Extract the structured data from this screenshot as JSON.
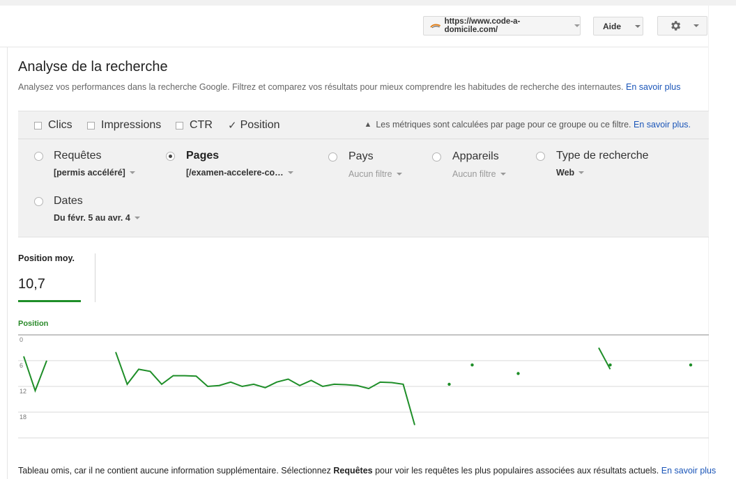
{
  "header": {
    "site_url": "https://www.code-a-domicile.com/",
    "help_label": "Aide"
  },
  "page": {
    "title": "Analyse de la recherche",
    "subtitle": "Analysez vos performances dans la recherche Google. Filtrez et comparez vos résultats pour mieux comprendre les habitudes de recherche des internautes.",
    "learn_more": "En savoir plus"
  },
  "metrics": {
    "items": [
      {
        "label": "Clics",
        "checked": false
      },
      {
        "label": "Impressions",
        "checked": false
      },
      {
        "label": "CTR",
        "checked": false
      },
      {
        "label": "Position",
        "checked": true
      }
    ],
    "notice": "Les métriques sont calculées par page pour ce groupe ou ce filtre.",
    "notice_link": "En savoir plus."
  },
  "dimensions": {
    "queries": {
      "label": "Requêtes",
      "value": "[permis accéléré]",
      "selected": false
    },
    "pages": {
      "label": "Pages",
      "value": "[/examen-accelere-co…",
      "selected": true
    },
    "countries": {
      "label": "Pays",
      "value": "Aucun filtre",
      "selected": false
    },
    "devices": {
      "label": "Appareils",
      "value": "Aucun filtre",
      "selected": false
    },
    "search_type": {
      "label": "Type de recherche",
      "value": "Web",
      "selected": false
    },
    "dates": {
      "label": "Dates",
      "value": "Du févr. 5 au avr. 4",
      "selected": false
    }
  },
  "stats": {
    "label": "Position moy.",
    "value": "10,7"
  },
  "chart_data": {
    "type": "line",
    "title": "Position",
    "y_reversed": true,
    "ylim": [
      0,
      24
    ],
    "yticks": [
      "0",
      "6",
      "12",
      "18"
    ],
    "color": "#1e8e28",
    "grid": true,
    "x": [
      1,
      2,
      3,
      4,
      5,
      6,
      7,
      8,
      9,
      10,
      11,
      12,
      13,
      14,
      15,
      16,
      17,
      18,
      19,
      20,
      21,
      22,
      23,
      24,
      25,
      26,
      27,
      28,
      29,
      30,
      31,
      32,
      33,
      34,
      35,
      36,
      37,
      38,
      39,
      40,
      41,
      42,
      43,
      44,
      45,
      46,
      47,
      48,
      49,
      50,
      51,
      52,
      53,
      54,
      55,
      56,
      57,
      58,
      59
    ],
    "values": [
      5,
      13,
      6,
      null,
      null,
      null,
      null,
      null,
      4,
      11.5,
      8,
      8.5,
      11.5,
      9.5,
      9.5,
      9.6,
      12,
      11.8,
      11,
      12,
      11.5,
      12.3,
      11,
      10.3,
      11.8,
      10.6,
      12,
      11.5,
      11.6,
      11.8,
      12.5,
      11,
      11.1,
      11.5,
      21,
      null,
      null,
      null,
      11.5,
      null,
      7,
      null,
      null,
      null,
      null,
      null,
      null,
      null,
      null,
      null,
      3,
      8,
      null,
      null,
      null,
      null,
      null,
      null,
      null
    ],
    "isolated_points": [
      {
        "x": 38,
        "y": 11.5
      },
      {
        "x": 40,
        "y": 7
      },
      {
        "x": 44,
        "y": 9
      },
      {
        "x": 52,
        "y": 7
      },
      {
        "x": 59,
        "y": 7
      }
    ]
  },
  "footer": {
    "text_before": "Tableau omis, car il ne contient aucune information supplémentaire. Sélectionnez ",
    "bold": "Requêtes",
    "text_after": " pour voir les requêtes les plus populaires associées aux résultats actuels.",
    "link": "En savoir plus"
  }
}
